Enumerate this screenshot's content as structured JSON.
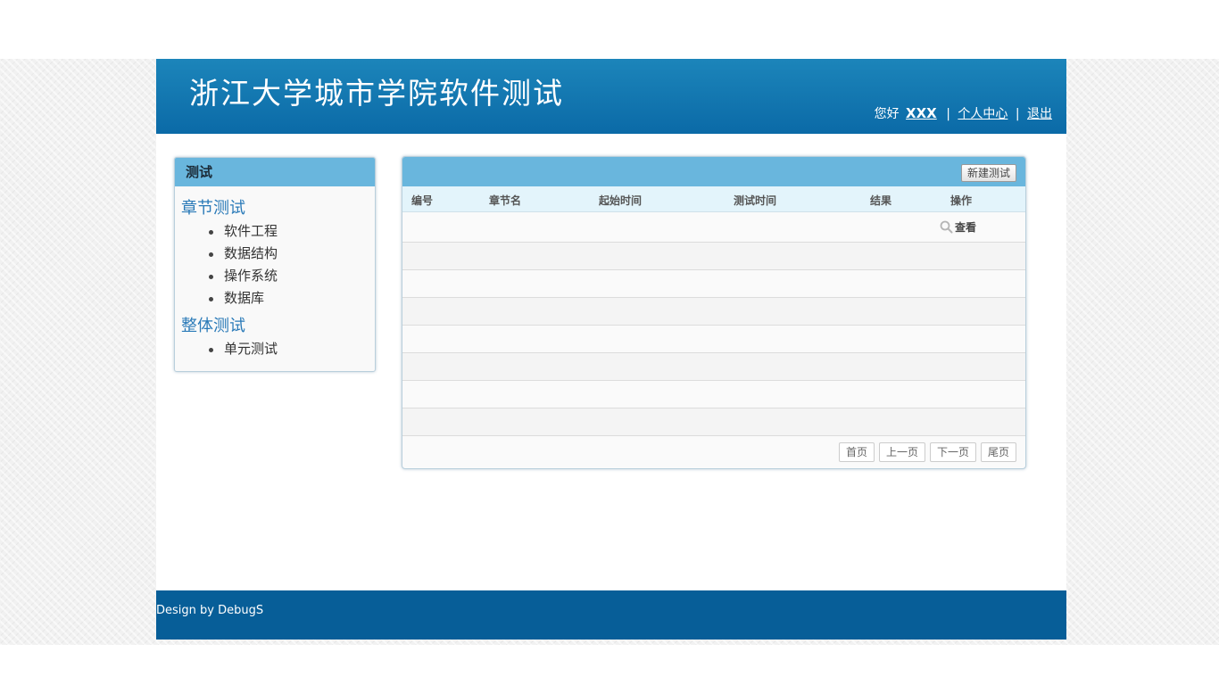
{
  "header": {
    "title": "浙江大学城市学院软件测试",
    "greeting": "您好",
    "username": "XXX",
    "separator": "|",
    "profile_link": "个人中心",
    "logout_link": "退出"
  },
  "sidebar": {
    "heading": "测试",
    "groups": [
      {
        "title": "章节测试",
        "items": [
          "软件工程",
          "数据结构",
          "操作系统",
          "数据库"
        ]
      },
      {
        "title": "整体测试",
        "items": [
          "单元测试"
        ]
      }
    ]
  },
  "panel": {
    "new_button": "新建测试",
    "columns": [
      "编号",
      "章节名",
      "起始时间",
      "测试时间",
      "结果",
      "操作"
    ],
    "rows": [
      {
        "id": "",
        "chapter": "",
        "start": "",
        "duration": "",
        "result": "",
        "action": "查看"
      }
    ],
    "pager": [
      "首页",
      "上一页",
      "下一页",
      "尾页"
    ]
  },
  "footer": {
    "text": "Design by DebugS"
  },
  "colors": {
    "header_top": "#1c85ba",
    "header_bottom": "#0b6aa7",
    "panel_bar": "#69b6dd",
    "column_header": "#e3f4fb",
    "footer": "#075e98",
    "link_blue": "#2a7ab8"
  },
  "icons": {
    "view": "magnifier-icon"
  }
}
